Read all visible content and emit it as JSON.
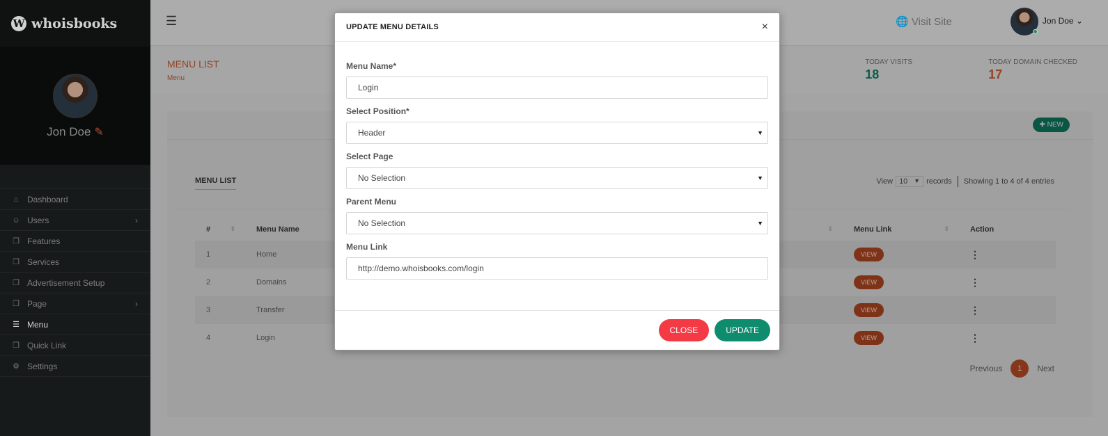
{
  "brand": {
    "name": "whoisbooks",
    "logo_letter": "W"
  },
  "profile": {
    "name": "Jon Doe"
  },
  "sidebar": {
    "items": [
      {
        "label": "Dashboard",
        "icon": "home-icon",
        "glyph": "⌂",
        "has_children": false,
        "active": false
      },
      {
        "label": "Users",
        "icon": "users-icon",
        "glyph": "☺",
        "has_children": true,
        "active": false
      },
      {
        "label": "Features",
        "icon": "copy-icon",
        "glyph": "❐",
        "has_children": false,
        "active": false
      },
      {
        "label": "Services",
        "icon": "copy-icon",
        "glyph": "❐",
        "has_children": false,
        "active": false
      },
      {
        "label": "Advertisement Setup",
        "icon": "copy-icon",
        "glyph": "❐",
        "has_children": false,
        "active": false
      },
      {
        "label": "Page",
        "icon": "copy-icon",
        "glyph": "❐",
        "has_children": true,
        "active": false
      },
      {
        "label": "Menu",
        "icon": "list-icon",
        "glyph": "☰",
        "has_children": false,
        "active": true
      },
      {
        "label": "Quick Link",
        "icon": "copy-icon",
        "glyph": "❐",
        "has_children": false,
        "active": false
      },
      {
        "label": "Settings",
        "icon": "gear-icon",
        "glyph": "⚙",
        "has_children": false,
        "active": false
      }
    ]
  },
  "topbar": {
    "visit_site": "Visit Site",
    "user_name": "Jon Doe"
  },
  "subbar": {
    "title": "MENU LIST",
    "breadcrumb": "Menu",
    "stats": [
      {
        "label": "TODAY VISITS",
        "value": "18"
      },
      {
        "label": "TODAY DOMAIN CHECKED",
        "value": "17"
      }
    ]
  },
  "card": {
    "new_label": "NEW",
    "list_title": "MENU LIST",
    "view_label": "View",
    "records_per_page": "10",
    "records_label": "records",
    "showing": "Showing 1 to 4 of 4 entries",
    "columns": [
      "#",
      "Menu Name",
      "Menu Link",
      "Action"
    ],
    "rows": [
      {
        "num": "1",
        "name": "Home",
        "link_label": "VIEW"
      },
      {
        "num": "2",
        "name": "Domains",
        "link_label": "VIEW"
      },
      {
        "num": "3",
        "name": "Transfer",
        "link_label": "VIEW"
      },
      {
        "num": "4",
        "name": "Login",
        "link_label": "VIEW"
      }
    ],
    "pager": {
      "previous": "Previous",
      "current": "1",
      "next": "Next"
    }
  },
  "modal": {
    "title": "UPDATE MENU DETAILS",
    "fields": {
      "menu_name": {
        "label": "Menu Name*",
        "value": "Login"
      },
      "position": {
        "label": "Select Position*",
        "value": "Header"
      },
      "page": {
        "label": "Select Page",
        "value": "No Selection"
      },
      "parent": {
        "label": "Parent Menu",
        "value": "No Selection"
      },
      "link": {
        "label": "Menu Link",
        "value": "http://demo.whoisbooks.com/login"
      }
    },
    "close_label": "CLOSE",
    "update_label": "UPDATE"
  },
  "colors": {
    "accent_orange": "#b8522a",
    "accent_green": "#0e8c6d",
    "close_red": "#f33a45"
  }
}
